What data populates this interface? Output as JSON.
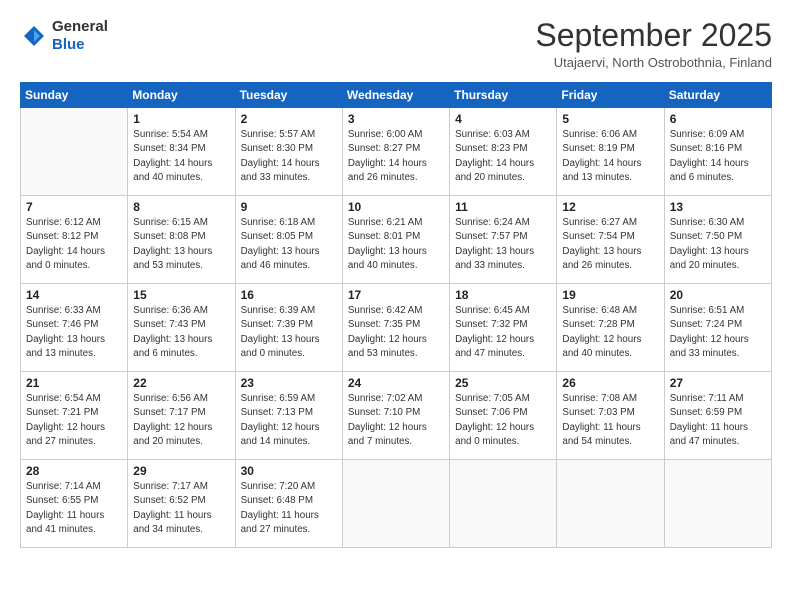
{
  "header": {
    "logo": {
      "line1": "General",
      "line2": "Blue"
    },
    "title": "September 2025",
    "location": "Utajaervi, North Ostrobothnia, Finland"
  },
  "weekdays": [
    "Sunday",
    "Monday",
    "Tuesday",
    "Wednesday",
    "Thursday",
    "Friday",
    "Saturday"
  ],
  "weeks": [
    [
      {
        "day": "",
        "empty": true
      },
      {
        "day": "1",
        "sunrise": "Sunrise: 5:54 AM",
        "sunset": "Sunset: 8:34 PM",
        "daylight": "Daylight: 14 hours and 40 minutes."
      },
      {
        "day": "2",
        "sunrise": "Sunrise: 5:57 AM",
        "sunset": "Sunset: 8:30 PM",
        "daylight": "Daylight: 14 hours and 33 minutes."
      },
      {
        "day": "3",
        "sunrise": "Sunrise: 6:00 AM",
        "sunset": "Sunset: 8:27 PM",
        "daylight": "Daylight: 14 hours and 26 minutes."
      },
      {
        "day": "4",
        "sunrise": "Sunrise: 6:03 AM",
        "sunset": "Sunset: 8:23 PM",
        "daylight": "Daylight: 14 hours and 20 minutes."
      },
      {
        "day": "5",
        "sunrise": "Sunrise: 6:06 AM",
        "sunset": "Sunset: 8:19 PM",
        "daylight": "Daylight: 14 hours and 13 minutes."
      },
      {
        "day": "6",
        "sunrise": "Sunrise: 6:09 AM",
        "sunset": "Sunset: 8:16 PM",
        "daylight": "Daylight: 14 hours and 6 minutes."
      }
    ],
    [
      {
        "day": "7",
        "sunrise": "Sunrise: 6:12 AM",
        "sunset": "Sunset: 8:12 PM",
        "daylight": "Daylight: 14 hours and 0 minutes."
      },
      {
        "day": "8",
        "sunrise": "Sunrise: 6:15 AM",
        "sunset": "Sunset: 8:08 PM",
        "daylight": "Daylight: 13 hours and 53 minutes."
      },
      {
        "day": "9",
        "sunrise": "Sunrise: 6:18 AM",
        "sunset": "Sunset: 8:05 PM",
        "daylight": "Daylight: 13 hours and 46 minutes."
      },
      {
        "day": "10",
        "sunrise": "Sunrise: 6:21 AM",
        "sunset": "Sunset: 8:01 PM",
        "daylight": "Daylight: 13 hours and 40 minutes."
      },
      {
        "day": "11",
        "sunrise": "Sunrise: 6:24 AM",
        "sunset": "Sunset: 7:57 PM",
        "daylight": "Daylight: 13 hours and 33 minutes."
      },
      {
        "day": "12",
        "sunrise": "Sunrise: 6:27 AM",
        "sunset": "Sunset: 7:54 PM",
        "daylight": "Daylight: 13 hours and 26 minutes."
      },
      {
        "day": "13",
        "sunrise": "Sunrise: 6:30 AM",
        "sunset": "Sunset: 7:50 PM",
        "daylight": "Daylight: 13 hours and 20 minutes."
      }
    ],
    [
      {
        "day": "14",
        "sunrise": "Sunrise: 6:33 AM",
        "sunset": "Sunset: 7:46 PM",
        "daylight": "Daylight: 13 hours and 13 minutes."
      },
      {
        "day": "15",
        "sunrise": "Sunrise: 6:36 AM",
        "sunset": "Sunset: 7:43 PM",
        "daylight": "Daylight: 13 hours and 6 minutes."
      },
      {
        "day": "16",
        "sunrise": "Sunrise: 6:39 AM",
        "sunset": "Sunset: 7:39 PM",
        "daylight": "Daylight: 13 hours and 0 minutes."
      },
      {
        "day": "17",
        "sunrise": "Sunrise: 6:42 AM",
        "sunset": "Sunset: 7:35 PM",
        "daylight": "Daylight: 12 hours and 53 minutes."
      },
      {
        "day": "18",
        "sunrise": "Sunrise: 6:45 AM",
        "sunset": "Sunset: 7:32 PM",
        "daylight": "Daylight: 12 hours and 47 minutes."
      },
      {
        "day": "19",
        "sunrise": "Sunrise: 6:48 AM",
        "sunset": "Sunset: 7:28 PM",
        "daylight": "Daylight: 12 hours and 40 minutes."
      },
      {
        "day": "20",
        "sunrise": "Sunrise: 6:51 AM",
        "sunset": "Sunset: 7:24 PM",
        "daylight": "Daylight: 12 hours and 33 minutes."
      }
    ],
    [
      {
        "day": "21",
        "sunrise": "Sunrise: 6:54 AM",
        "sunset": "Sunset: 7:21 PM",
        "daylight": "Daylight: 12 hours and 27 minutes."
      },
      {
        "day": "22",
        "sunrise": "Sunrise: 6:56 AM",
        "sunset": "Sunset: 7:17 PM",
        "daylight": "Daylight: 12 hours and 20 minutes."
      },
      {
        "day": "23",
        "sunrise": "Sunrise: 6:59 AM",
        "sunset": "Sunset: 7:13 PM",
        "daylight": "Daylight: 12 hours and 14 minutes."
      },
      {
        "day": "24",
        "sunrise": "Sunrise: 7:02 AM",
        "sunset": "Sunset: 7:10 PM",
        "daylight": "Daylight: 12 hours and 7 minutes."
      },
      {
        "day": "25",
        "sunrise": "Sunrise: 7:05 AM",
        "sunset": "Sunset: 7:06 PM",
        "daylight": "Daylight: 12 hours and 0 minutes."
      },
      {
        "day": "26",
        "sunrise": "Sunrise: 7:08 AM",
        "sunset": "Sunset: 7:03 PM",
        "daylight": "Daylight: 11 hours and 54 minutes."
      },
      {
        "day": "27",
        "sunrise": "Sunrise: 7:11 AM",
        "sunset": "Sunset: 6:59 PM",
        "daylight": "Daylight: 11 hours and 47 minutes."
      }
    ],
    [
      {
        "day": "28",
        "sunrise": "Sunrise: 7:14 AM",
        "sunset": "Sunset: 6:55 PM",
        "daylight": "Daylight: 11 hours and 41 minutes."
      },
      {
        "day": "29",
        "sunrise": "Sunrise: 7:17 AM",
        "sunset": "Sunset: 6:52 PM",
        "daylight": "Daylight: 11 hours and 34 minutes."
      },
      {
        "day": "30",
        "sunrise": "Sunrise: 7:20 AM",
        "sunset": "Sunset: 6:48 PM",
        "daylight": "Daylight: 11 hours and 27 minutes."
      },
      {
        "day": "",
        "empty": true
      },
      {
        "day": "",
        "empty": true
      },
      {
        "day": "",
        "empty": true
      },
      {
        "day": "",
        "empty": true
      }
    ]
  ]
}
